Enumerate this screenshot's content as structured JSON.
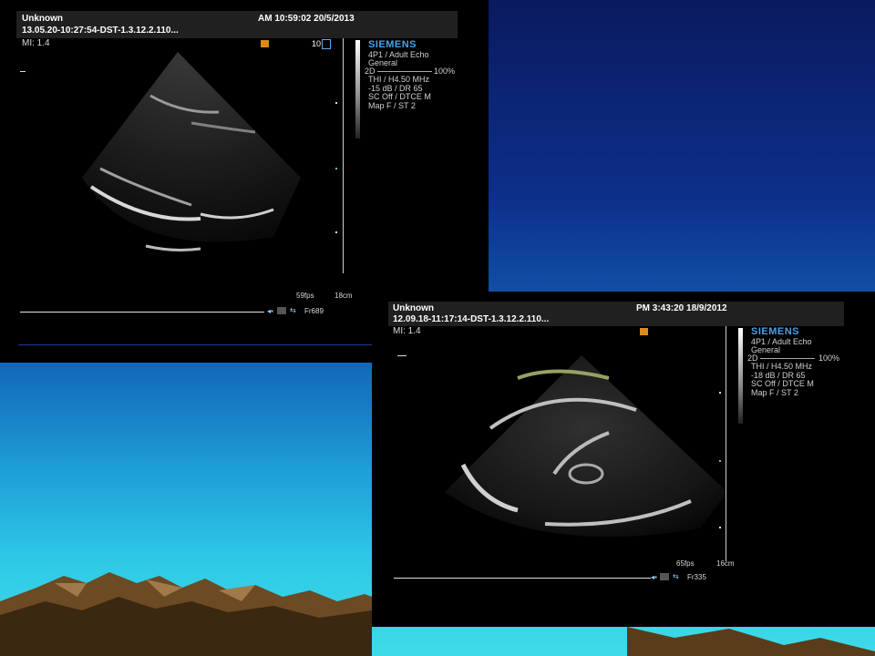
{
  "panel_a": {
    "patient": "Unknown",
    "datetime": "AM 10:59:02 20/5/2013",
    "study_id": "13.05.20-10:27:54-DST-1.3.12.2.110...",
    "mi": "MI:  1.4",
    "depth_marker": "10",
    "brand": "SIEMENS",
    "probe": "4P1 / Adult Echo",
    "preset": "General",
    "mode": "2D",
    "gain": "100%",
    "params": "THI / H4.50 MHz\n-15 dB / DR 65\nSC Off / DTCE M\nMap F / ST 2",
    "fps": "59fps",
    "depth": "18cm",
    "frame": "Fr689"
  },
  "panel_b": {
    "patient": "Unknown",
    "datetime": "PM 3:43:20 18/9/2012",
    "study_id": "12.09.18-11:17:14-DST-1.3.12.2.110...",
    "mi": "MI:  1.4",
    "brand": "SIEMENS",
    "probe": "4P1 / Adult Echo",
    "preset": "General",
    "mode": "2D",
    "gain": "100%",
    "params": "THI / H4.50 MHz\n-18 dB / DR 65\nSC Off / DTCE M\nMap F / ST 2",
    "fps": "65fps",
    "depth": "16cm",
    "frame": "Fr335"
  }
}
